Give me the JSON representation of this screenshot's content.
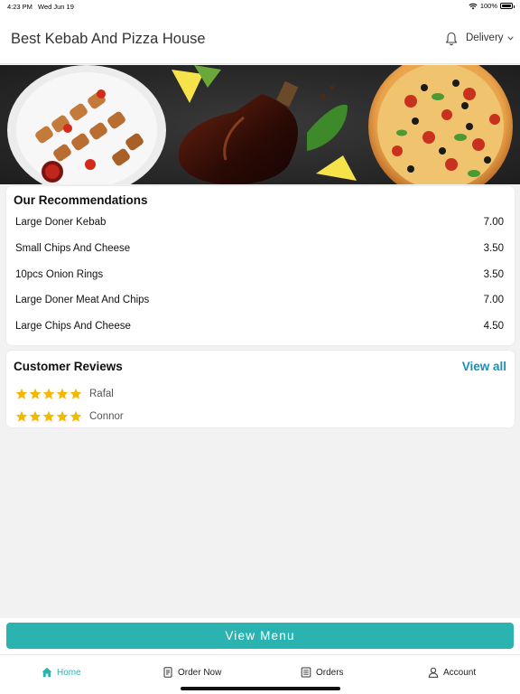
{
  "status_bar": {
    "time": "4:23 PM",
    "date": "Wed Jun 19",
    "battery": "100%"
  },
  "header": {
    "title": "Best Kebab And Pizza House",
    "order_mode": "Delivery",
    "bell_icon": "bell-icon",
    "chevron_icon": "chevron-down-icon"
  },
  "recommendations": {
    "title": "Our Recommendations",
    "items": [
      {
        "name": "Large Doner Kebab",
        "price": "7.00"
      },
      {
        "name": "Small Chips And Cheese",
        "price": "3.50"
      },
      {
        "name": "10pcs Onion Rings",
        "price": "3.50"
      },
      {
        "name": "Large Doner Meat And Chips",
        "price": "7.00"
      },
      {
        "name": "Large Chips And Cheese",
        "price": "4.50"
      }
    ]
  },
  "reviews": {
    "title": "Customer Reviews",
    "view_all": "View all",
    "items": [
      {
        "name": "Rafal",
        "rating": 5
      },
      {
        "name": "Connor",
        "rating": 5
      }
    ]
  },
  "view_menu": "View Menu",
  "tabs": [
    {
      "label": "Home",
      "icon": "home-icon",
      "active": true
    },
    {
      "label": "Order Now",
      "icon": "order-icon",
      "active": false
    },
    {
      "label": "Orders",
      "icon": "orders-icon",
      "active": false
    },
    {
      "label": "Account",
      "icon": "account-icon",
      "active": false
    }
  ],
  "colors": {
    "accent": "#2bb3b1",
    "link": "#1b8fb6",
    "star": "#f5b800"
  }
}
